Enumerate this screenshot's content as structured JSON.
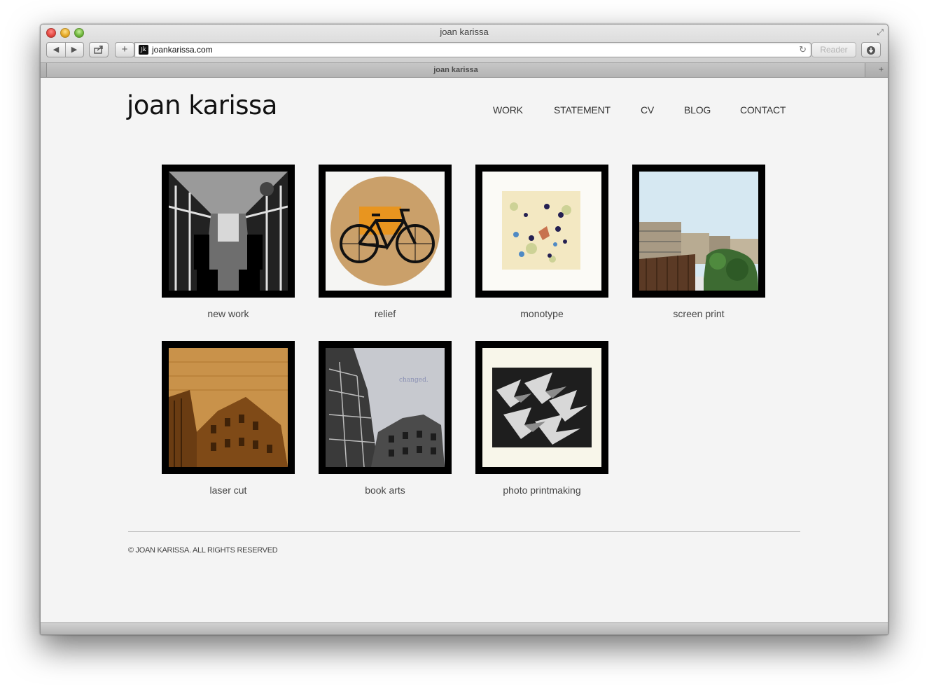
{
  "window": {
    "title": "joan karissa",
    "tab_title": "joan karissa",
    "url": "joankarissa.com",
    "favicon_text": "jk",
    "reader_label": "Reader",
    "toolbar_icons": [
      "back-icon",
      "forward-icon",
      "share-icon",
      "add-bookmark-icon",
      "reload-icon",
      "download-icon",
      "fullscreen-icon",
      "new-tab-icon"
    ]
  },
  "site": {
    "title": "joan karissa",
    "nav": [
      "WORK",
      "STATEMENT",
      "CV",
      "BLOG",
      "CONTACT"
    ],
    "gallery": [
      {
        "caption": "new work",
        "art": "bus-interior-print"
      },
      {
        "caption": "relief",
        "art": "bicycle-circle-print"
      },
      {
        "caption": "monotype",
        "art": "dotted-monotype"
      },
      {
        "caption": "screen print",
        "art": "rowhouses-screen-print"
      },
      {
        "caption": "laser cut",
        "art": "building-laser-cut"
      },
      {
        "caption": "book arts",
        "art": "building-book-art",
        "art_text": "changed."
      },
      {
        "caption": "photo printmaking",
        "art": "paper-cranes-print"
      }
    ],
    "footer": "© JOAN KARISSA. ALL RIGHTS RESERVED"
  },
  "colors": {
    "page_background": "#f4f4f4",
    "frame": "#000000",
    "text": "#333333"
  }
}
